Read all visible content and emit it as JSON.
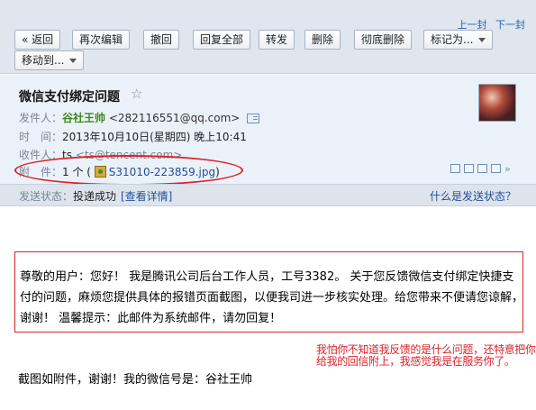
{
  "nav": {
    "prev": "上一封",
    "next": "下一封"
  },
  "toolbar": {
    "back": "« 返回",
    "reedit": "再次编辑",
    "recall": "撤回",
    "reply_all": "回复全部",
    "forward": "转发",
    "delete": "删除",
    "delete_perm": "彻底删除",
    "mark_as": "标记为...",
    "move_to": "移动到..."
  },
  "email": {
    "subject": "微信支付绑定问题",
    "from_label": "发件人：",
    "from_name": "谷社王帅",
    "from_addr": "<282116551@qq.com>",
    "time_label": "时　间：",
    "time_value": "2013年10月10日(星期四) 晚上10:41",
    "to_label": "收件人：",
    "to_name": "ts",
    "to_addr": "<ts@tencent.com>",
    "att_label": "附　件：",
    "att_count": "1 个 (",
    "att_name": "S31010-223859.jpg",
    "att_close": ")"
  },
  "status": {
    "label": "发送状态：",
    "value": "投递成功",
    "details": "[查看详情]",
    "help": "什么是发送状态？"
  },
  "body": {
    "text": "尊敬的用户：您好！ 我是腾讯公司后台工作人员，工号3382。 关于您反馈微信支付绑定快捷支付的问题，麻烦您提供具体的报错页面截图，以便我司进一步核实处理。给您带来不便请您谅解，谢谢！ 温馨提示：此邮件为系统邮件，请勿回复！",
    "annotation": "我怕你不知道我反馈的是什么问题，还特意把你给我的回信附上，我感觉我是在服务你了。",
    "bottom": "截图如附件，谢谢！我的微信号是：谷社王帅"
  },
  "colors": {
    "highlight": "#d8232a",
    "link": "#234f9a",
    "sender": "#3b8a1a"
  }
}
